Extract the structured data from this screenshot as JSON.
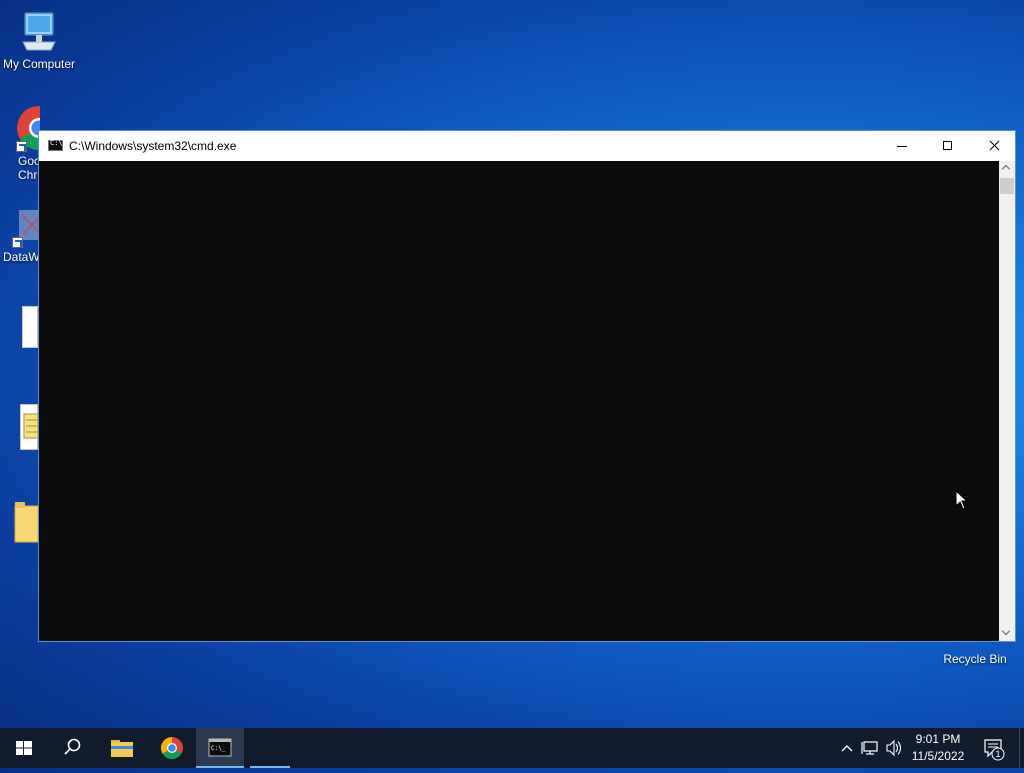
{
  "desktop": {
    "icons": [
      {
        "label": "My Computer"
      },
      {
        "label": "Goo\nChro"
      },
      {
        "label": "DataW"
      },
      {
        "label": ""
      },
      {
        "label": ""
      },
      {
        "label": ""
      },
      {
        "label": "Recycle Bin"
      }
    ]
  },
  "window": {
    "title": "C:\\Windows\\system32\\cmd.exe",
    "console_text": ""
  },
  "taskbar": {
    "items": [
      {
        "name": "start-button"
      },
      {
        "name": "search-button"
      },
      {
        "name": "file-explorer"
      },
      {
        "name": "google-chrome"
      },
      {
        "name": "command-prompt"
      }
    ],
    "time": "9:01 PM",
    "date": "11/5/2022",
    "notification_count": "1"
  },
  "colors": {
    "taskbar_bg": "#101c2c",
    "console_bg": "#0c0c0c",
    "accent": "#76b9ed"
  }
}
